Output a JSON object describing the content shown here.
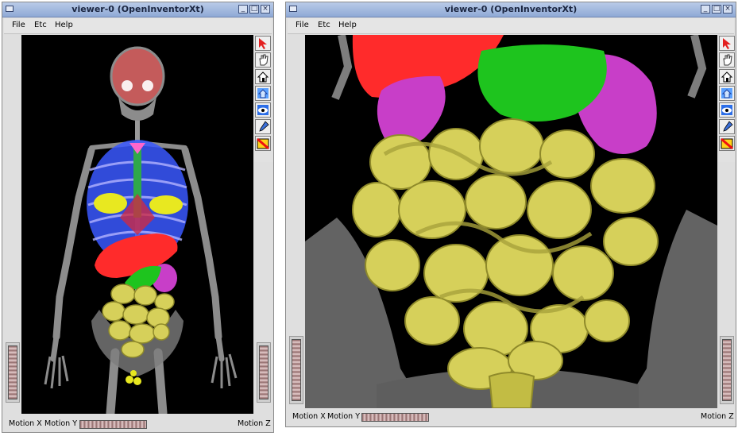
{
  "windows": [
    {
      "title": "viewer-0 (OpenInventorXt)",
      "menu": [
        "File",
        "Etc",
        "Help"
      ],
      "wheels": {
        "motion_x": "Motion X",
        "motion_y": "Motion Y",
        "motion_z": "Motion Z"
      },
      "tools": [
        "select-arrow-icon",
        "hand-view-icon",
        "home-icon",
        "set-home-icon",
        "view-all-eye-icon",
        "seek-icon",
        "projection-icon"
      ]
    },
    {
      "title": "viewer-0 (OpenInventorXt)",
      "menu": [
        "File",
        "Etc",
        "Help"
      ],
      "wheels": {
        "motion_x": "Motion X",
        "motion_y": "Motion Y",
        "motion_z": "Motion Z"
      },
      "tools": [
        "select-arrow-icon",
        "hand-view-icon",
        "home-icon",
        "set-home-icon",
        "view-all-eye-icon",
        "seek-icon",
        "projection-icon"
      ]
    }
  ],
  "colors": {
    "titlebar": "#9fb5dd",
    "bone": "#8c8c8c",
    "ribs": "#3a58ff",
    "lungs": "#e8e820",
    "liver": "#ff2b2b",
    "stomach": "#1ec41e",
    "spleen": "#c83ec8",
    "intestine": "#d6d05a",
    "background": "#000000"
  }
}
